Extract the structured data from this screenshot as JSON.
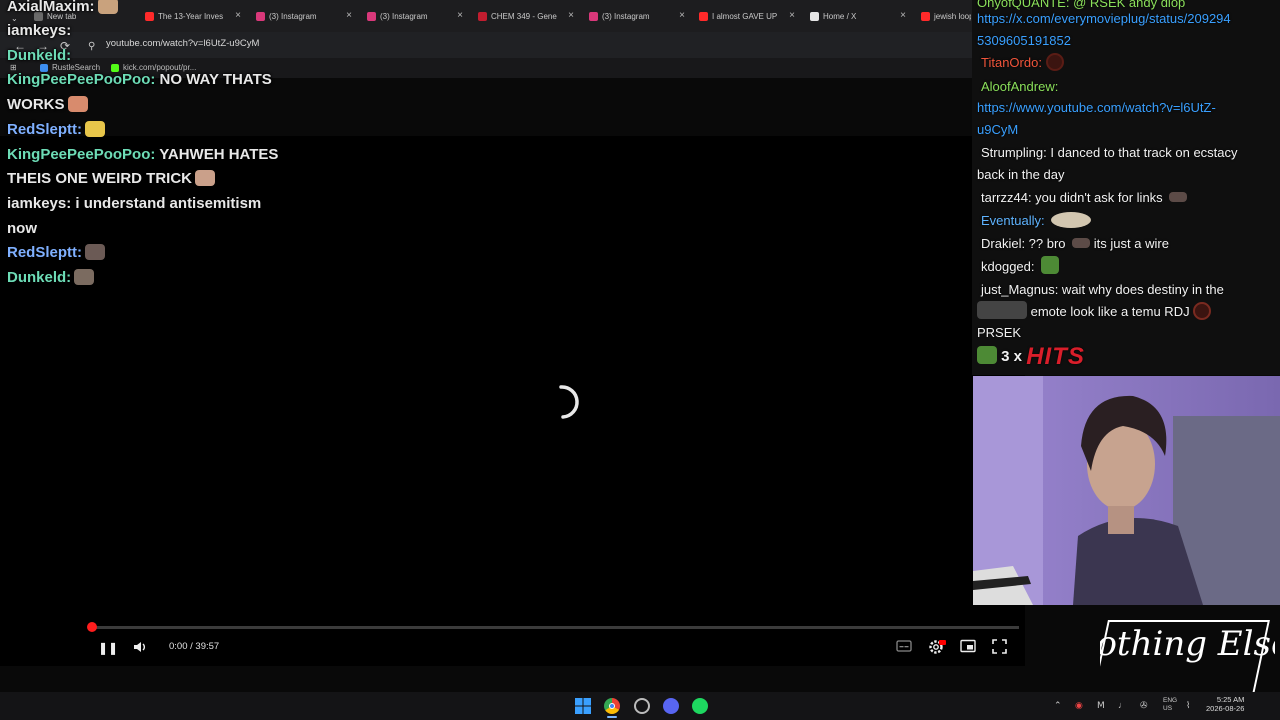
{
  "browser": {
    "tabs": [
      {
        "label": "New tab",
        "color": "#6b6b6b"
      },
      {
        "label": "The 13-Year Inves",
        "color": "#ff2a2a"
      },
      {
        "label": "(3) Instagram",
        "color": "#d9387a"
      },
      {
        "label": "(3) Instagram",
        "color": "#d9387a"
      },
      {
        "label": "CHEM 349 - Gene",
        "color": "#c21d2f"
      },
      {
        "label": "(3) Instagram",
        "color": "#d9387a"
      },
      {
        "label": "I almost GAVE UP",
        "color": "#ff2a2a"
      },
      {
        "label": "Home / X",
        "color": "#e6e6e6"
      },
      {
        "label": "jewish loophole",
        "color": "#ff2a2a"
      }
    ],
    "url": "youtube.com/watch?v=l6UtZ-u9CyM",
    "bookmarks": [
      {
        "label": "RustleSearch",
        "color": "#3d8ef0"
      },
      {
        "label": "kick.com/popout/pr...",
        "color": "#53fc18"
      }
    ]
  },
  "left_chat": [
    {
      "user": "AxialMaxim",
      "text": "",
      "user_class": "u-white",
      "emote_color": "#c9a27d"
    },
    {
      "user": "iamkeys",
      "text": "",
      "user_class": "u-white",
      "emote_color": ""
    },
    {
      "user": "Dunkeld",
      "text": "",
      "user_class": "u-teal",
      "emote_color": ""
    },
    {
      "user": "KingPeePeePooPoo",
      "text": "NO WAY THATS",
      "user_class": "u-teal",
      "emote_color": ""
    },
    {
      "user": "",
      "text": "WORKS",
      "user_class": "u-white",
      "emote_color": "#d88b6d"
    },
    {
      "user": "RedSleptt",
      "text": "",
      "user_class": "u-blue",
      "emote_color": "#e8c64a"
    },
    {
      "user": "KingPeePeePooPoo",
      "text": "YAHWEH HATES",
      "user_class": "u-teal",
      "emote_color": ""
    },
    {
      "user": "",
      "text": "THEIS ONE WEIRD TRICK",
      "user_class": "u-white",
      "emote_color": "#caa08a"
    },
    {
      "user": "iamkeys",
      "text": "i understand antisemitism",
      "user_class": "u-white",
      "emote_color": ""
    },
    {
      "user": "",
      "text": "now",
      "user_class": "u-white",
      "emote_color": ""
    },
    {
      "user": "RedSleptt",
      "text": "",
      "user_class": "u-blue",
      "emote_color": "#6b5a55"
    },
    {
      "user": "Dunkeld",
      "text": "",
      "user_class": "u-teal",
      "emote_color": "#7b6b60"
    }
  ],
  "player": {
    "time": "0:00 / 39:57",
    "progress": 0,
    "controls": {
      "pause": "❚❚",
      "volume": "🔊",
      "settings": "⚙",
      "miniplayer": "▭",
      "fullscreen": "⛶",
      "captions": "▭"
    }
  },
  "right_chat": {
    "top_fragment": "OnyofQUANTE: @ RSEK andy diop",
    "link1_a": "https://x.com/everymovieplug/status/209294",
    "link1_b": "5309605191852",
    "titan": "TitanOrdo:",
    "aloof": "AloofAndrew:",
    "link2_a": "https://www.youtube.com/watch?v=l6UtZ-",
    "link2_b": "u9CyM",
    "strumpling": "Strumpling: I danced to that track on ecstacy",
    "strumpling2": "back in the day",
    "tarrzz": "tarrzz44: you didn't ask for links",
    "eventually": "Eventually:",
    "drakiel_a": "Drakiel: ?? bro",
    "drakiel_b": "its just a wire",
    "kdogged": "kdogged:",
    "magnus_a": "just_Magnus: wait why does destiny in the",
    "magnus_b": "emote look like a temu RDJ",
    "prsek": "PRSEK",
    "combo_count": "3 x",
    "combo_text": "HITS"
  },
  "logo_text": "Nothing Else?",
  "taskbar": {
    "lang_1": "ENG",
    "lang_2": "US",
    "time": "5:25 AM",
    "date": "2026-08-26"
  }
}
